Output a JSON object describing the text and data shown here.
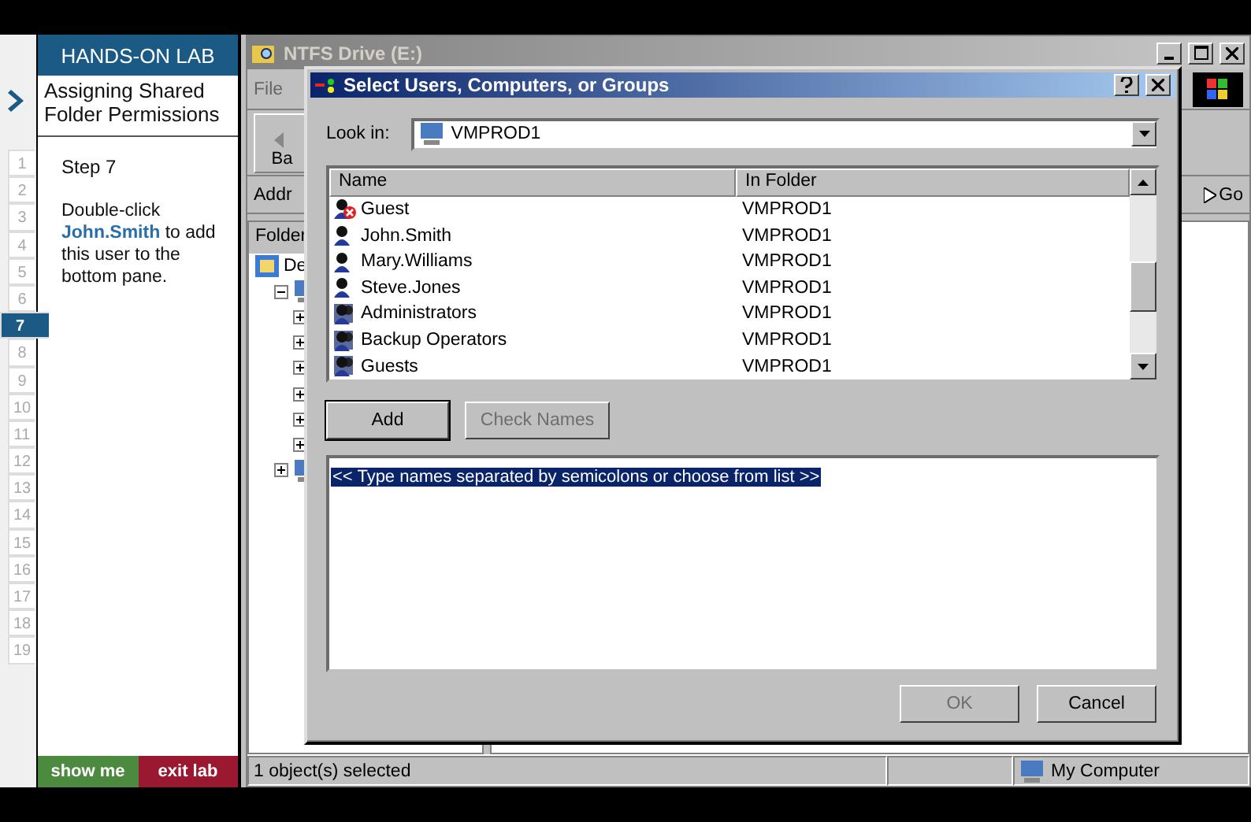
{
  "lab": {
    "header": "HANDS-ON LAB",
    "title": "Assigning Shared Folder Permissions",
    "step": "Step 7",
    "instruction": "Double-click **John.Smith** to add this user to the bottom pane.",
    "steps": [
      {
        "label": "1",
        "selected": false
      },
      {
        "label": "2",
        "selected": false
      },
      {
        "label": "3",
        "selected": false
      },
      {
        "label": "4",
        "selected": false
      },
      {
        "label": "5",
        "selected": false
      },
      {
        "label": "6",
        "selected": false
      },
      {
        "label": "7",
        "selected": true
      },
      {
        "label": "8",
        "selected": false
      },
      {
        "label": "9",
        "selected": false
      },
      {
        "label": "10",
        "selected": false
      },
      {
        "label": "11",
        "selected": false
      },
      {
        "label": "12",
        "selected": false
      },
      {
        "label": "13",
        "selected": false
      },
      {
        "label": "14",
        "selected": false
      },
      {
        "label": "15",
        "selected": false
      },
      {
        "label": "16",
        "selected": false
      },
      {
        "label": "17",
        "selected": false
      },
      {
        "label": "18",
        "selected": false
      },
      {
        "label": "19",
        "selected": false
      }
    ],
    "buttons": [
      "show me",
      "exit lab"
    ]
  },
  "explorer": {
    "title": "NTFS Drive (E:)",
    "menu": "File",
    "back": "Ba",
    "address": "Addr",
    "go": "Go",
    "folders": "Folder",
    "tree": {
      "label": "De",
      "children": [
        {
          "expanded": true,
          "children": [
            {
              "expanded": false
            },
            {
              "expanded": false
            },
            {
              "expanded": false
            },
            {
              "expanded": false
            },
            {
              "expanded": false
            },
            {
              "expanded": false
            }
          ]
        },
        {
          "expanded": false
        }
      ]
    },
    "status": "1 object(s) selected",
    "zone": "My Computer"
  },
  "dialog": {
    "title": "Select Users, Computers, or Groups",
    "look_in_label": "Look in:",
    "look_in": "VMPROD1",
    "columns": [
      "Name",
      "In Folder"
    ],
    "rows": [
      {
        "kind": "disabled-user",
        "name": "Guest",
        "folder": "VMPROD1"
      },
      {
        "kind": "user",
        "name": "John.Smith",
        "folder": "VMPROD1"
      },
      {
        "kind": "user",
        "name": "Mary.Williams",
        "folder": "VMPROD1"
      },
      {
        "kind": "user",
        "name": "Steve.Jones",
        "folder": "VMPROD1"
      },
      {
        "kind": "group",
        "name": "Administrators",
        "folder": "VMPROD1"
      },
      {
        "kind": "group",
        "name": "Backup Operators",
        "folder": "VMPROD1"
      },
      {
        "kind": "group",
        "name": "Guests",
        "folder": "VMPROD1"
      }
    ],
    "add": {
      "label": "Add",
      "disabled": false
    },
    "check": {
      "label": "Check Names",
      "disabled": true
    },
    "names_hint": "<< Type names separated by semicolons or choose from list >>",
    "ok": {
      "label": "OK",
      "disabled": true
    },
    "cancel": {
      "label": "Cancel",
      "disabled": false
    }
  }
}
